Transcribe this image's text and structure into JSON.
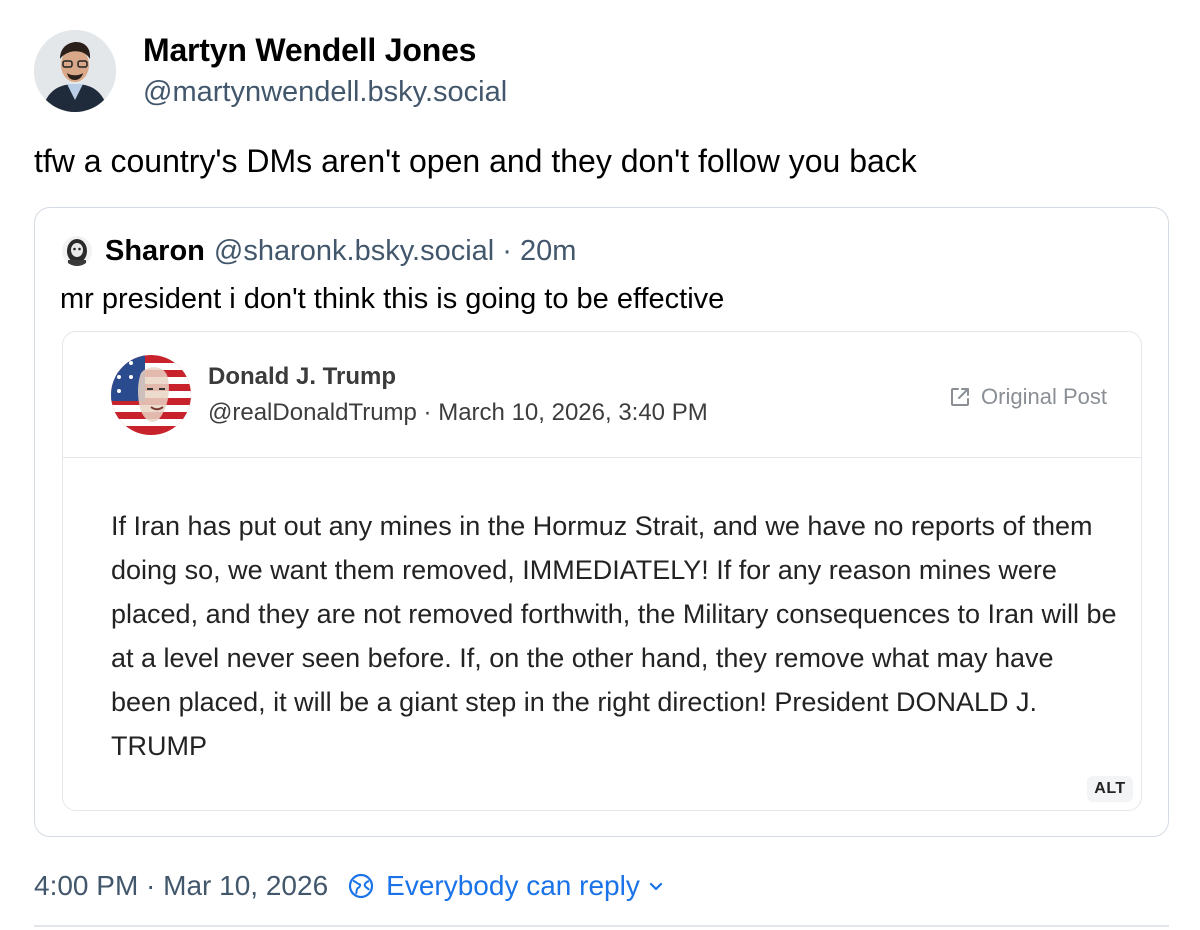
{
  "post": {
    "author_name": "Martyn Wendell Jones",
    "author_handle": "@martynwendell.bsky.social",
    "text": "tfw a country's DMs aren't open and they don't follow you back",
    "timestamp": "4:00 PM · Mar 10, 2026",
    "reply_setting": "Everybody can reply"
  },
  "quote": {
    "author_name": "Sharon",
    "author_handle": "@sharonk.bsky.social · 20m",
    "text": "mr president i don't think this is going to be effective"
  },
  "embed": {
    "author_name": "Donald J. Trump",
    "meta": "@realDonaldTrump · March 10, 2026, 3:40 PM",
    "original_post_label": "Original Post",
    "body": "If Iran has put out any mines in the Hormuz Strait, and we have no reports of them doing so, we want them removed, IMMEDIATELY! If for any reason mines were placed, and they are not removed forthwith, the Military consequences to Iran will be at a level never seen before. If, on the other hand, they remove what may have been placed, it will be a giant step in the right direction! President DONALD J. TRUMP",
    "alt_badge": "ALT"
  },
  "colors": {
    "accent": "#1a73e8",
    "muted": "#42576c",
    "border": "#d4dbe2"
  },
  "icons": {
    "reply_setting": "globe-icon",
    "dropdown": "chevron-down-icon",
    "original_post": "external-link-icon"
  }
}
